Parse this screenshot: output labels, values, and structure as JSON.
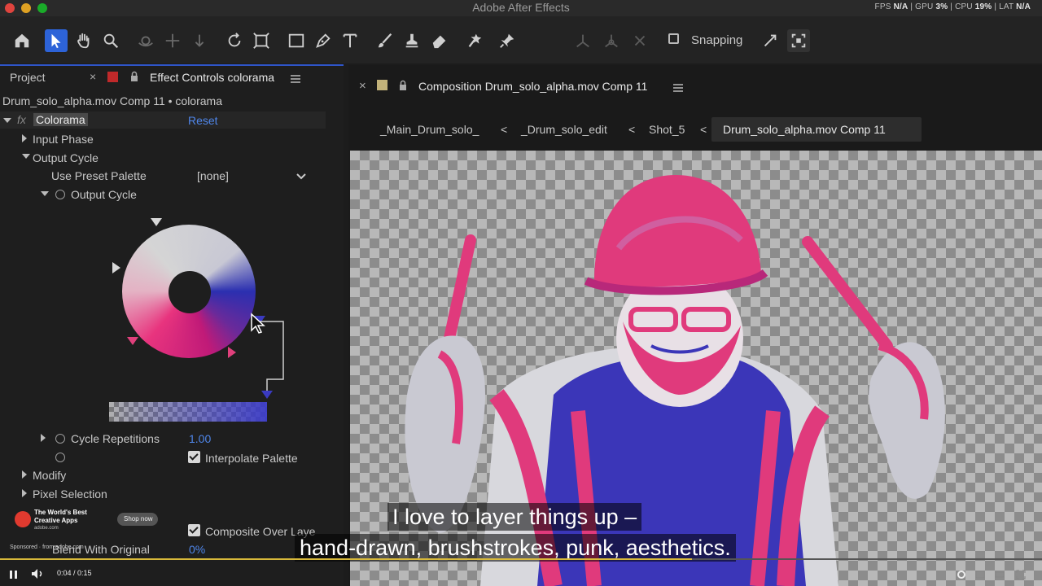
{
  "window": {
    "title": "Adobe After Effects",
    "perf": {
      "fps_label": "FPS",
      "fps": "N/A",
      "gpu_label": "GPU",
      "gpu": "3%",
      "cpu_label": "CPU",
      "cpu": "19%",
      "lat_label": "LAT",
      "lat": "N/A"
    }
  },
  "toolbar": {
    "tools": [
      "home-icon",
      "selection-icon",
      "hand-icon",
      "zoom-icon",
      "orbit-icon",
      "pan-icon",
      "dolly-icon",
      "rotate-icon",
      "camera-behind-icon",
      "rectangle-icon",
      "pen-icon",
      "type-icon",
      "brush-icon",
      "clone-stamp-icon",
      "eraser-icon",
      "roto-brush-icon",
      "puppet-pin-icon"
    ],
    "snapping_label": "Snapping",
    "accent": "#2d63d8"
  },
  "left_panel": {
    "tab_project": "Project",
    "tab_effect": "Effect Controls colorama",
    "layer_title": "Drum_solo_alpha.mov Comp 11 • colorama",
    "fx": "fx",
    "effect_name": "Colorama",
    "reset": "Reset",
    "input_phase": "Input Phase",
    "output_cycle_group": "Output Cycle",
    "use_preset_label": "Use Preset Palette",
    "preset_value": "[none]",
    "output_cycle": "Output Cycle",
    "cycle_repetitions_label": "Cycle Repetitions",
    "cycle_repetitions": "1.00",
    "interpolate_palette": "Interpolate Palette",
    "modify": "Modify",
    "pixel_selection": "Pixel Selection",
    "composite_over_layer": "Composite Over Laye",
    "blend_with_original": "Blend With Original",
    "blend_value": "0%"
  },
  "comp_panel": {
    "title": "Composition Drum_solo_alpha.mov Comp 11",
    "breadcrumbs": [
      "_Main_Drum_solo_",
      "_Drum_solo_edit",
      "Shot_5",
      "Drum_solo_alpha.mov Comp 11"
    ]
  },
  "video": {
    "subtitle_line1": "I love to layer things up –",
    "subtitle_line2": "hand-drawn, brushstrokes, punk, aesthetics.",
    "time": "0:04 / 0:15",
    "progress": 0.664,
    "ad_title": "The World's Best Creative Apps",
    "ad_domain": "adobe.com",
    "ad_cta": "Shop now",
    "ad_sponsored": "Sponsored",
    "ad_source": "from adobe.com"
  }
}
